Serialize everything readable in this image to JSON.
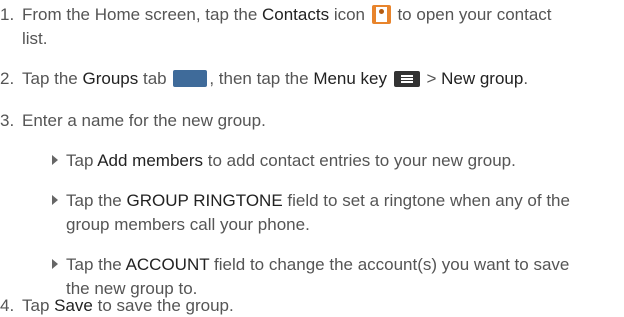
{
  "steps": [
    {
      "num": "1.",
      "a": "From the Home screen, tap the ",
      "b": "Contacts",
      "c": " icon ",
      "icon": "contacts-app-icon",
      "d": " to open your contact",
      "cont": "list."
    },
    {
      "num": "2.",
      "a": "Tap the ",
      "b": "Groups",
      "c": " tab ",
      "icon": "groups-tab-icon",
      "d": ", then tap the ",
      "e": "Menu key",
      "icon2": "menu-key-icon",
      "f": " > ",
      "g": "New group",
      "h": "."
    },
    {
      "num": "3.",
      "a": "Enter a name for the new group."
    },
    {
      "num": "4.",
      "a": "Tap ",
      "b": "Save",
      "c": " to save the group."
    }
  ],
  "subitems": [
    {
      "a": "Tap ",
      "b": "Add members",
      "c": " to add contact entries to your new group."
    },
    {
      "a": "Tap the ",
      "b": "GROUP RINGTONE",
      "c": " field to set a ringtone when any of the",
      "cont": "group members call your phone."
    },
    {
      "a": "Tap the ",
      "b": "ACCOUNT",
      "c": " field to change the account(s) you want to save",
      "cont": "the new group to."
    }
  ]
}
